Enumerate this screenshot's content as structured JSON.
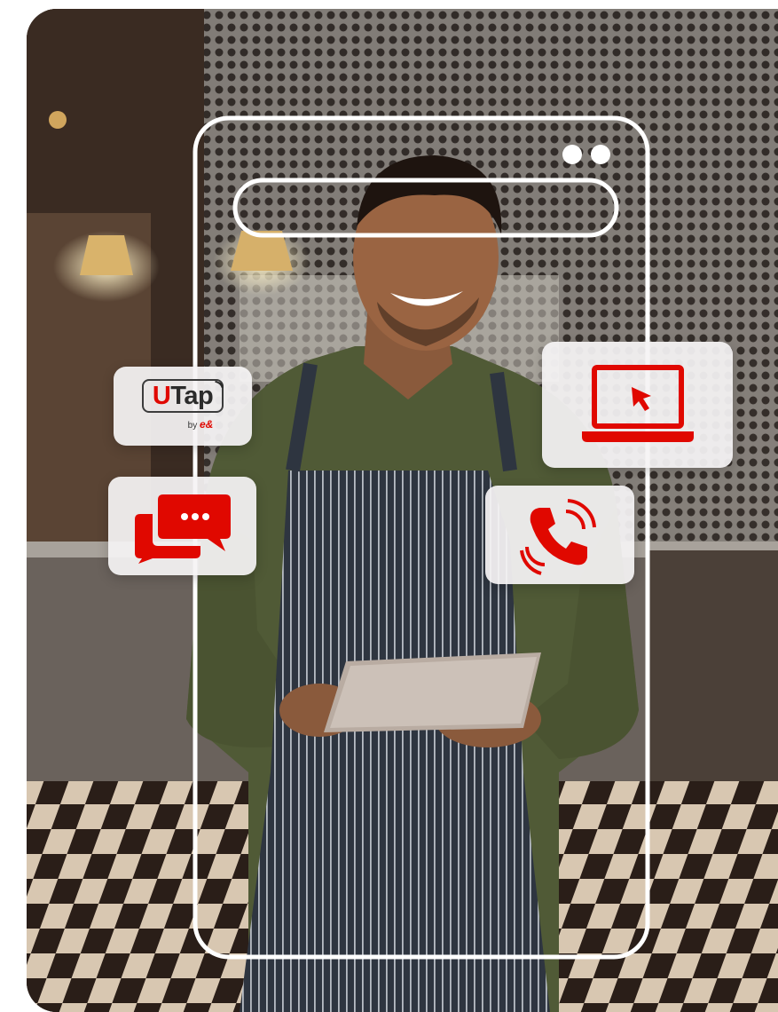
{
  "scene": {
    "description_icon": "waiter-with-tablet-photo"
  },
  "badges": {
    "utap_brand_u": "U",
    "utap_brand_rest": "Tap",
    "utap_by": "by",
    "utap_eand": "e&"
  },
  "icons": {
    "chat": "chat-bubbles-icon",
    "laptop": "laptop-cursor-icon",
    "phone": "phone-call-icon",
    "wifi": "contactless-waves-icon"
  },
  "colors": {
    "brand_red": "#e00800",
    "card_bg": "#f5f3f4",
    "frame_white": "#ffffff"
  }
}
